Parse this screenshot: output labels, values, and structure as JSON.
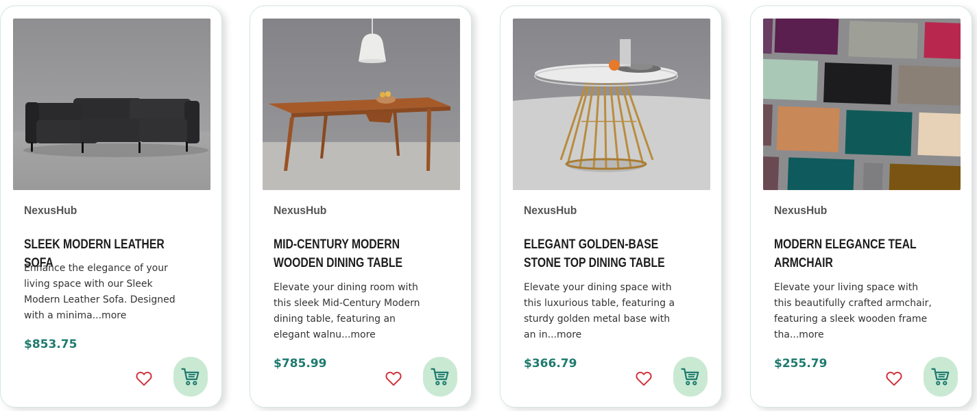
{
  "products": [
    {
      "brand": "NexusHub",
      "title": "Sleek Modern Leather Sofa",
      "description": "Enhance the elegance of your living space with our Sleek Modern Leather Sofa. Designed with a minima",
      "more_label": "...more",
      "price": "$853.75",
      "image_icon": "leather-sofa"
    },
    {
      "brand": "NexusHub",
      "title": "Mid-Century Modern Wooden Dining Table",
      "description": "Elevate your dining room with this sleek Mid-Century Modern dining table, featuring an elegant walnu",
      "more_label": "...more",
      "price": "$785.99",
      "image_icon": "wooden-dining-table"
    },
    {
      "brand": "NexusHub",
      "title": "Elegant Golden-Base Stone Top Dining Table",
      "description": "Elevate your dining space with this luxurious table, featuring a sturdy golden metal base with an in",
      "more_label": "...more",
      "price": "$366.79",
      "image_icon": "golden-base-table"
    },
    {
      "brand": "NexusHub",
      "title": "Modern Elegance Teal Armchair",
      "description": "Elevate your living space with this beautifully crafted armchair, featuring a sleek wooden frame tha",
      "more_label": "...more",
      "price": "$255.79",
      "image_icon": "fabric-swatches"
    }
  ],
  "colors": {
    "price": "#1e7a6e",
    "heart": "#d0303a",
    "cart_bg": "#c9e9d3",
    "cart_icon": "#1e7a6e"
  }
}
